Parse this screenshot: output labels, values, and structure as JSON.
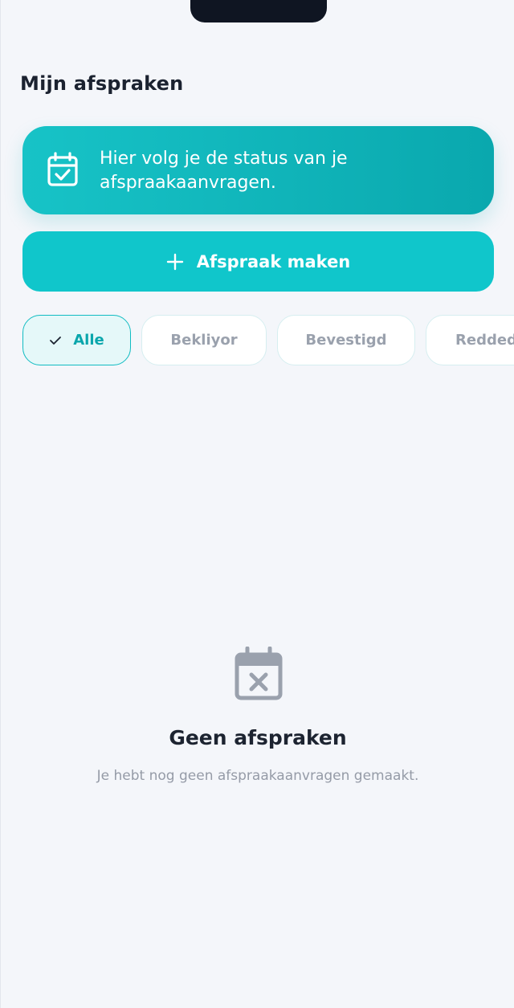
{
  "header": {
    "title": "Mijn afspraken"
  },
  "info_banner": {
    "icon": "calendar-check-icon",
    "text": "Hier volg je de status van je afspraakaanvragen."
  },
  "primary_action": {
    "icon": "plus-icon",
    "label": "Afspraak maken"
  },
  "filters": [
    {
      "label": "Alle",
      "active": true,
      "icon": "check-icon"
    },
    {
      "label": "Bekliyor",
      "active": false
    },
    {
      "label": "Bevestigd",
      "active": false
    },
    {
      "label": "Redded",
      "active": false
    }
  ],
  "empty_state": {
    "icon": "calendar-x-icon",
    "title": "Geen afspraken",
    "subtitle": "Je hebt nog geen afspraakaanvragen gemaakt."
  },
  "colors": {
    "accent": "#10c6cb",
    "accent_dark": "#0aa8ae",
    "background": "#f4f6fa",
    "text_dark": "#1b2230",
    "muted": "#959ba7"
  }
}
